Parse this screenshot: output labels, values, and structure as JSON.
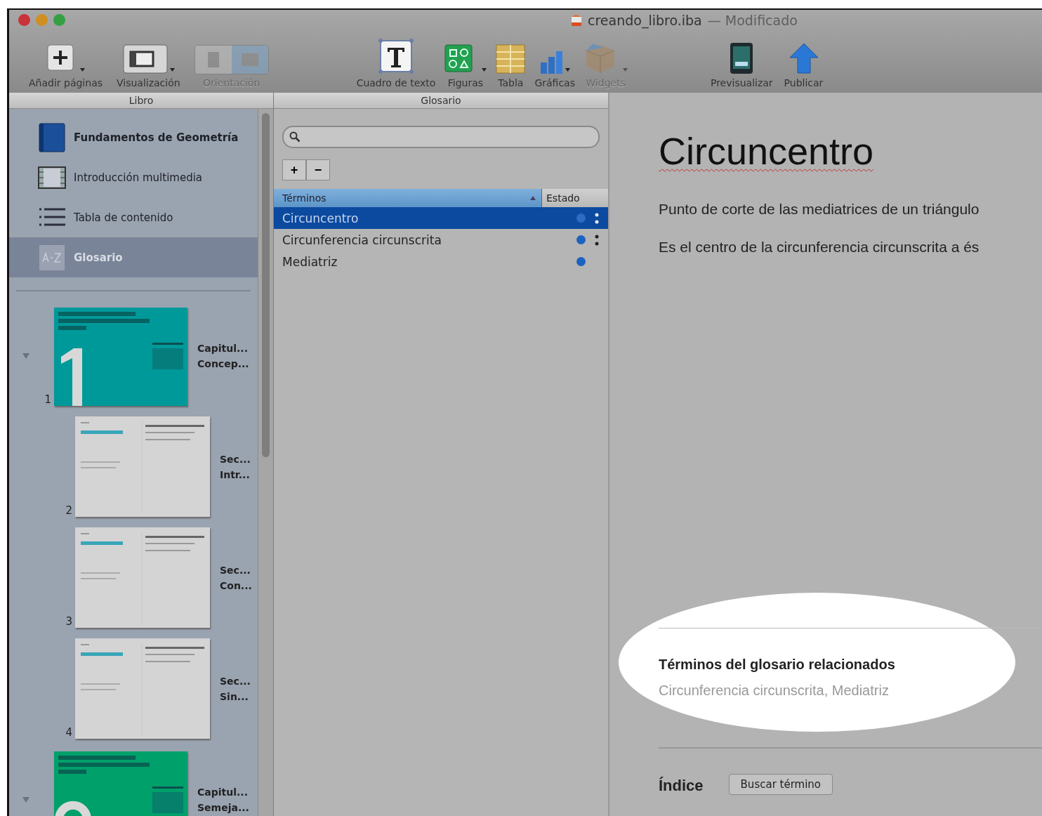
{
  "window": {
    "title": "creando_libro.iba",
    "status": "— Modificado"
  },
  "toolbar": {
    "left": [
      {
        "kind": "add",
        "label": "Añadir páginas",
        "disabled": false,
        "menu": true
      },
      {
        "kind": "view",
        "label": "Visualización",
        "disabled": false,
        "menu": true
      },
      {
        "kind": "orientation",
        "label": "Orientación",
        "disabled": true,
        "menu": false,
        "segments": [
          {
            "selected": false
          },
          {
            "selected": true
          }
        ]
      }
    ],
    "center": [
      {
        "kind": "textbox",
        "label": "Cuadro de texto",
        "disabled": false,
        "menu": false
      },
      {
        "kind": "shapes",
        "label": "Figuras",
        "disabled": false,
        "menu": true
      },
      {
        "kind": "table",
        "label": "Tabla",
        "disabled": false,
        "menu": false
      },
      {
        "kind": "charts",
        "label": "Gráficas",
        "disabled": false,
        "menu": true
      },
      {
        "kind": "widgets",
        "label": "Widgets",
        "disabled": true,
        "menu": true
      }
    ],
    "right": [
      {
        "kind": "preview",
        "label": "Previsualizar",
        "disabled": false,
        "menu": false
      },
      {
        "kind": "publish",
        "label": "Publicar",
        "disabled": false,
        "menu": false
      }
    ]
  },
  "sidebar": {
    "header": "Libro",
    "items": [
      {
        "kind": "book",
        "label": "Fundamentos de Geometría",
        "selected": false
      },
      {
        "kind": "media",
        "label": "Introducción multimedia",
        "selected": false
      },
      {
        "kind": "toc",
        "label": "Tabla de contenido",
        "selected": false
      },
      {
        "kind": "glossary",
        "label": "Glosario",
        "selected": true
      }
    ],
    "pages": [
      {
        "kind": "chapter",
        "number": "1",
        "line_1": "Capitul...",
        "line_2": "Concep...",
        "color": "#00999a",
        "expanded": true
      },
      {
        "kind": "section",
        "number": "2",
        "line_1": "Sec...",
        "line_2": "Intr..."
      },
      {
        "kind": "section",
        "number": "3",
        "line_1": "Sec...",
        "line_2": "Con..."
      },
      {
        "kind": "section",
        "number": "4",
        "line_1": "Sec...",
        "line_2": "Sin..."
      },
      {
        "kind": "chapter",
        "line_1": "Capitul...",
        "line_2": "Semeja...",
        "color": "#00a06a",
        "expanded": true
      }
    ]
  },
  "glossary": {
    "header": "Glosario",
    "add_button": "+",
    "remove_button": "−",
    "columns": [
      "Términos",
      "Estado"
    ],
    "terms": [
      {
        "term": "Circuncentro",
        "selected": true,
        "linked": true
      },
      {
        "term": "Circunferencia circunscrita",
        "selected": false,
        "linked": true
      },
      {
        "term": "Mediatriz",
        "selected": false,
        "linked": false
      }
    ]
  },
  "content": {
    "title": "Circuncentro",
    "paragraphs": [
      "Punto de corte de las mediatrices de un triángulo",
      "Es el centro de la circunferencia circunscrita a és"
    ],
    "related_heading": "Términos del glosario relacionados",
    "related_terms": "Circunferencia circunscrita, Mediatriz",
    "index_heading": "Índice",
    "index_button": "Buscar término"
  }
}
